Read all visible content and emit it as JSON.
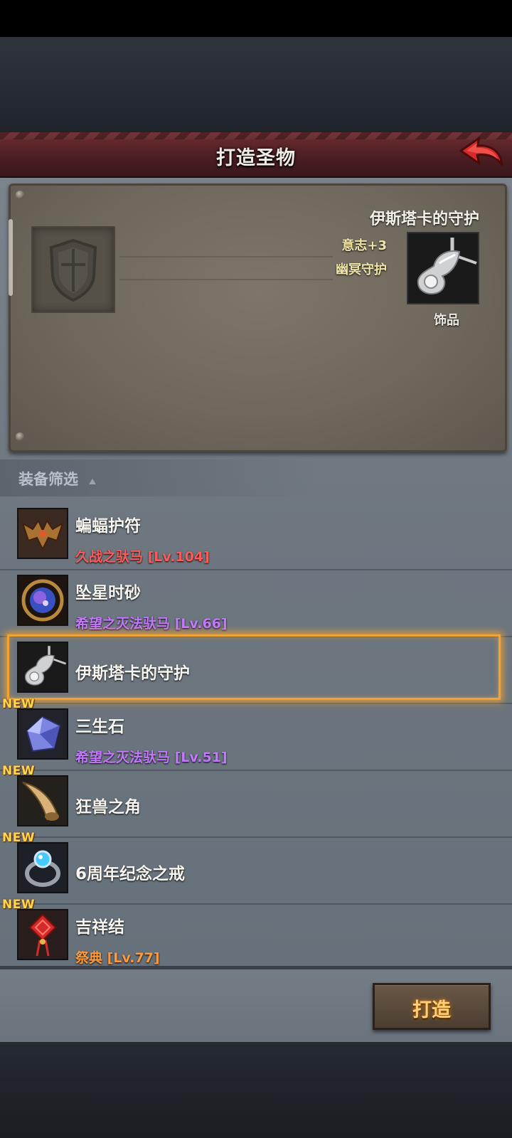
{
  "header": {
    "title": "打造圣物",
    "back_icon": "back-arrow-icon"
  },
  "preview": {
    "item_name": "伊斯塔卡的守护",
    "stats": [
      "意志+3",
      "幽冥守护"
    ],
    "category": "饰品",
    "placeholder_icon": "shield-icon"
  },
  "filter": {
    "label": "装备筛选",
    "icon": "triangle-up-icon"
  },
  "items": [
    {
      "name": "蝙蝠护符",
      "sub": "久战之驮马 [Lv.104]",
      "sub_color": "#ff5a5a",
      "new": "",
      "icon": "bat-amulet-icon"
    },
    {
      "name": "坠星时砂",
      "sub": "希望之灭法驮马 [Lv.66]",
      "sub_color": "#c477ff",
      "new": "",
      "icon": "hourglass-orb-icon"
    },
    {
      "name": "伊斯塔卡的守护",
      "sub": "",
      "new": "",
      "icon": "silver-charm-icon",
      "selected": true
    },
    {
      "name": "三生石",
      "sub": "希望之灭法驮马 [Lv.51]",
      "sub_color": "#c477ff",
      "new": "NEW",
      "icon": "crystal-stone-icon"
    },
    {
      "name": "狂兽之角",
      "sub": "",
      "new": "NEW",
      "icon": "horn-icon"
    },
    {
      "name": "6周年纪念之戒",
      "sub": "",
      "new": "NEW",
      "icon": "ring-icon"
    },
    {
      "name": "吉祥结",
      "sub": "祭典 [Lv.77]",
      "sub_color": "#ff9a3c",
      "new": "NEW",
      "icon": "chinese-knot-icon"
    }
  ],
  "actions": {
    "craft_label": "打造"
  }
}
